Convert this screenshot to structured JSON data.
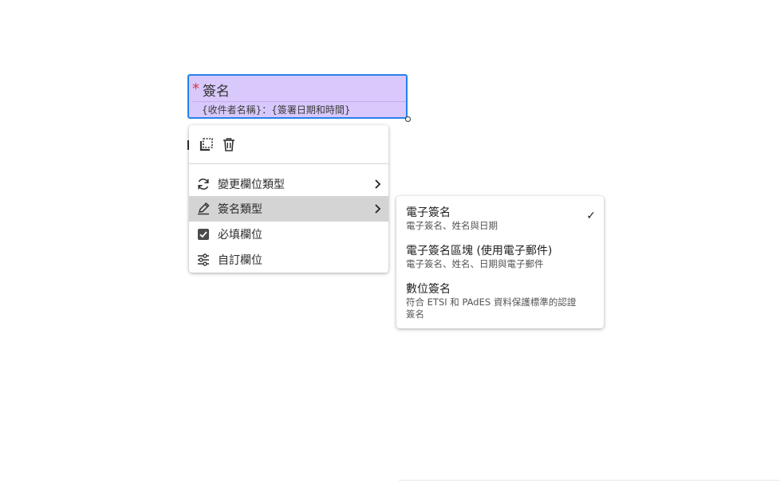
{
  "field": {
    "required_marker": "*",
    "label": "簽名",
    "subtitle": "{收件者名稱}：{簽署日期和時間}"
  },
  "toolbar": {
    "duplicate_icon": "duplicate-icon",
    "delete_icon": "trash-icon"
  },
  "menu": {
    "items": [
      {
        "label": "變更欄位類型",
        "icon": "refresh-icon",
        "has_submenu": true
      },
      {
        "label": "簽名類型",
        "icon": "pen-sign-icon",
        "has_submenu": true,
        "active": true
      },
      {
        "label": "必填欄位",
        "icon": "checkbox-checked-icon",
        "checked": true
      },
      {
        "label": "自訂欄位",
        "icon": "sliders-icon"
      }
    ]
  },
  "submenu": {
    "items": [
      {
        "title": "電子簽名",
        "desc": "電子簽名、姓名與日期",
        "selected": true,
        "check": "✓"
      },
      {
        "title": "電子簽名區塊 (使用電子郵件)",
        "desc": "電子簽名、姓名、日期與電子郵件"
      },
      {
        "title": "數位簽名",
        "desc": "符合 ETSI 和 PAdES 資料保護標準的認證簽名"
      }
    ]
  },
  "colors": {
    "field_fill": "#d9c8fb",
    "field_border": "#2680eb",
    "required": "#d7373f",
    "active_item": "#d4d4d4"
  }
}
